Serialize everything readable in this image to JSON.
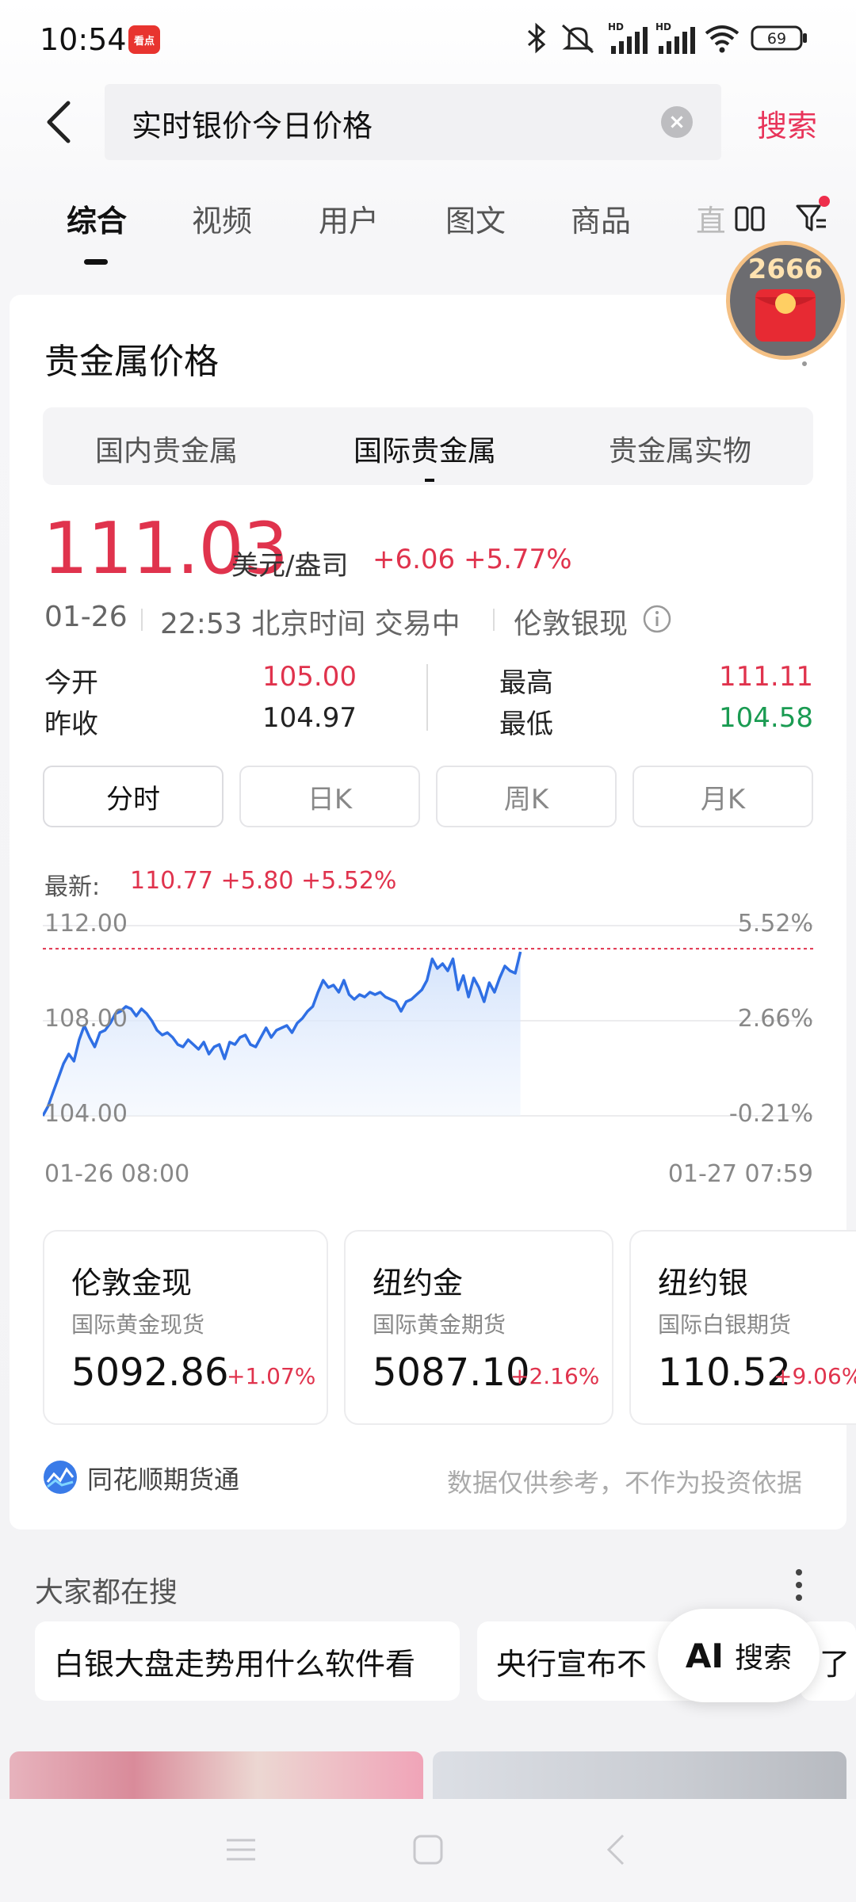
{
  "status_bar": {
    "time": "10:54",
    "app_badge": "看点",
    "network_1": "HD",
    "network_2": "HD",
    "battery": "69"
  },
  "search": {
    "query": "实时银价今日价格",
    "button": "搜索"
  },
  "tabs": [
    {
      "label": "综合",
      "active": true
    },
    {
      "label": "视频"
    },
    {
      "label": "用户"
    },
    {
      "label": "图文"
    },
    {
      "label": "商品"
    },
    {
      "label": "直"
    }
  ],
  "red_packet": {
    "count": "2666"
  },
  "card": {
    "title": "贵金属价格",
    "segments": [
      {
        "label": "国内贵金属"
      },
      {
        "label": "国际贵金属",
        "active": true
      },
      {
        "label": "贵金属实物"
      }
    ],
    "price": "111.03",
    "unit": "美元/盎司",
    "change": "+6.06 +5.77%",
    "date": "01-26",
    "time_status": "22:53 北京时间 交易中",
    "instrument": "伦敦银现",
    "stats": {
      "open_label": "今开",
      "open": "105.00",
      "prev_label": "昨收",
      "prev": "104.97",
      "high_label": "最高",
      "high": "111.11",
      "low_label": "最低",
      "low": "104.58"
    },
    "ktabs": [
      "分时",
      "日K",
      "周K",
      "月K"
    ],
    "latest_label": "最新:",
    "latest_value": "110.77 +5.80 +5.52%",
    "axis": {
      "y_top": "112.00",
      "y_mid": "108.00",
      "y_bot": "104.00",
      "pct_top": "5.52%",
      "pct_mid": "2.66%",
      "pct_bot": "-0.21%",
      "x_start": "01-26 08:00",
      "x_end": "01-27 07:59"
    },
    "markets": [
      {
        "name": "伦敦金现",
        "sub": "国际黄金现货",
        "price": "5092.86",
        "pct": "+1.07%"
      },
      {
        "name": "纽约金",
        "sub": "国际黄金期货",
        "price": "5087.10",
        "pct": "+2.16%"
      },
      {
        "name": "纽约银",
        "sub": "国际白银期货",
        "price": "110.52",
        "pct": "+9.06%"
      }
    ],
    "source": "同花顺期货通",
    "disclaimer": "数据仅供参考，不作为投资依据"
  },
  "hot": {
    "title": "大家都在搜",
    "items": [
      "白银大盘走势用什么软件看",
      "央行宣布不",
      "了"
    ]
  },
  "ai_button": {
    "ai": "AI",
    "label": "搜索"
  },
  "chart_data": {
    "type": "line",
    "x": [
      "01-26 08:00",
      "01-27 07:59"
    ],
    "ylim": [
      104.0,
      112.0
    ],
    "y_ticks": [
      "104.00",
      "108.00",
      "112.00"
    ],
    "pct_ticks": [
      "-0.21%",
      "2.66%",
      "5.52%"
    ],
    "reference_line": 111.03,
    "series": [
      {
        "values": [
          104.0,
          104.4,
          105.0,
          105.6,
          106.2,
          106.6,
          106.3,
          107.2,
          107.8,
          107.3,
          106.9,
          107.5,
          107.6,
          107.9,
          108.3,
          108.4,
          108.6,
          108.5,
          108.2,
          108.5,
          108.3,
          108.0,
          107.6,
          107.4,
          107.5,
          107.3,
          107.0,
          106.9,
          107.2,
          107.0,
          106.8,
          107.1,
          106.6,
          106.9,
          107.0,
          106.4,
          107.1,
          107.0,
          107.3,
          107.4,
          107.0,
          106.9,
          107.3,
          107.7,
          107.3,
          107.6,
          107.7,
          107.8,
          107.5,
          107.9,
          108.1,
          108.4,
          108.6,
          109.2,
          109.7,
          109.4,
          109.5,
          109.2,
          109.7,
          109.1,
          108.9,
          109.1,
          109.0,
          109.2,
          109.1,
          109.2,
          109.0,
          108.9,
          108.8,
          108.4,
          108.8,
          108.9,
          109.1,
          109.3,
          109.7,
          110.6,
          110.2,
          110.4,
          110.1,
          110.6,
          109.3,
          109.9,
          109.0,
          109.8,
          109.4,
          108.8,
          109.6,
          109.2,
          109.8,
          110.3,
          110.1,
          110.0,
          110.9
        ]
      }
    ]
  }
}
